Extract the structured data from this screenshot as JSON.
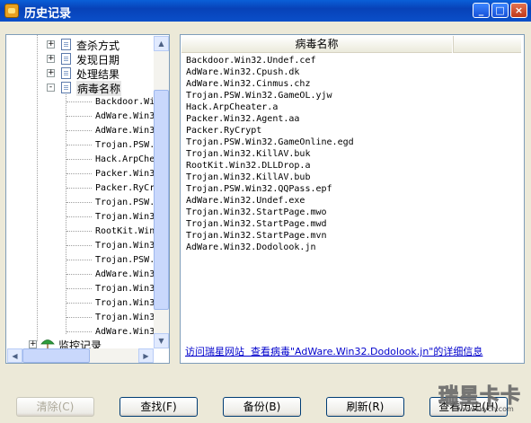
{
  "window": {
    "title": "历史记录"
  },
  "tree": {
    "categories": [
      {
        "label": "查杀方式",
        "expand": "+"
      },
      {
        "label": "发现日期",
        "expand": "+"
      },
      {
        "label": "处理结果",
        "expand": "+"
      },
      {
        "label": "病毒名称",
        "expand": "-"
      }
    ],
    "leaves": [
      "Backdoor.Wi",
      "AdWare.Win3",
      "AdWare.Win3",
      "Trojan.PSW.",
      "Hack.ArpChe",
      "Packer.Win3",
      "Packer.RyCr",
      "Trojan.PSW.",
      "Trojan.Win3",
      "RootKit.Win",
      "Trojan.Win3",
      "Trojan.PSW.",
      "AdWare.Win3",
      "Trojan.Win3",
      "Trojan.Win3",
      "Trojan.Win3",
      "AdWare.Win3"
    ],
    "monitor": {
      "label": "监控记录",
      "expand": "+"
    }
  },
  "list": {
    "header": "病毒名称",
    "rows": [
      "Backdoor.Win32.Undef.cef",
      "AdWare.Win32.Cpush.dk",
      "AdWare.Win32.Cinmus.chz",
      "Trojan.PSW.Win32.GameOL.yjw",
      "Hack.ArpCheater.a",
      "Packer.Win32.Agent.aa",
      "Packer.RyCrypt",
      "Trojan.PSW.Win32.GameOnline.egd",
      "Trojan.Win32.KillAV.buk",
      "RootKit.Win32.DLLDrop.a",
      "Trojan.Win32.KillAV.bub",
      "Trojan.PSW.Win32.QQPass.epf",
      "AdWare.Win32.Undef.exe",
      "Trojan.Win32.StartPage.mwo",
      "Trojan.Win32.StartPage.mwd",
      "Trojan.Win32.StartPage.mvn",
      "AdWare.Win32.Dodolook.jn"
    ]
  },
  "info": {
    "visit_link": "访问瑞星网站",
    "detail_text": "查看病毒\"AdWare.Win32.Dodolook.jn\"的详细信息"
  },
  "buttons": {
    "clear": "清除(C)",
    "find": "查找(F)",
    "backup": "备份(B)",
    "refresh": "刷新(R)",
    "history": "查看历史(H)"
  },
  "watermark": {
    "text": "瑞星卡卡",
    "sub": "www.skycn.com"
  },
  "colors": {
    "title_bar": "#0842B8",
    "link": "#0000CC",
    "panel_border": "#7F9DB9"
  }
}
